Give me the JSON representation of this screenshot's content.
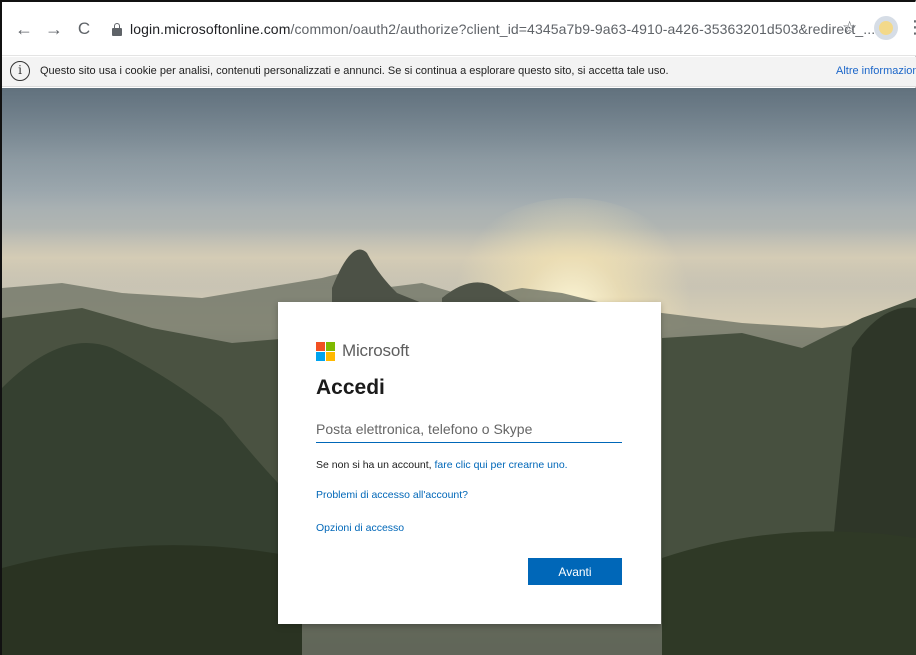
{
  "browser": {
    "url_host": "login.microsoftonline.com",
    "url_path": "/common/oauth2/authorize?client_id=4345a7b9-9a63-4910-a426-35363201d503&redirect_..."
  },
  "icons": {
    "back": "←",
    "forward": "→",
    "reload": "C",
    "star": "☆",
    "menu": "⋮",
    "info": "i"
  },
  "cookie_bar": {
    "text": "Questo sito usa i cookie per analisi, contenuti personalizzati e annunci. Se si continua a esplorare questo sito, si accetta tale uso.",
    "link": "Altre informazioni"
  },
  "login": {
    "brand": "Microsoft",
    "title": "Accedi",
    "email_placeholder": "Posta elettronica, telefono o Skype",
    "no_account_text": "Se non si ha un account, ",
    "create_link": "fare clic qui per crearne uno.",
    "problems_link": "Problemi di accesso all'account?",
    "options_link": "Opzioni di accesso",
    "next_button": "Avanti"
  },
  "colors": {
    "ms_red": "#f25022",
    "ms_green": "#7fba00",
    "ms_blue": "#00a4ef",
    "ms_yellow": "#ffb900",
    "accent": "#0067b8"
  }
}
